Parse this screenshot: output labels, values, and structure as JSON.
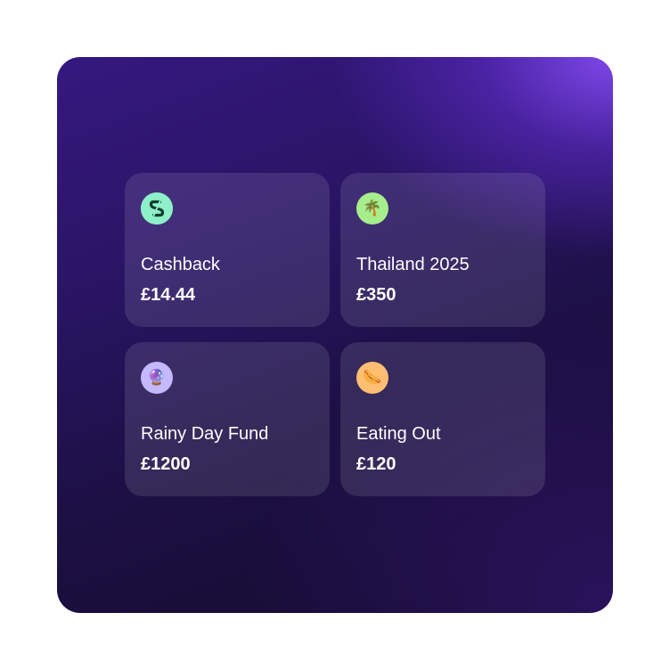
{
  "pots": [
    {
      "name": "Cashback",
      "amount": "£14.44",
      "icon": "cashback-s-icon",
      "icon_glyph": "S",
      "icon_bg": "#8ef0c8",
      "icon_fg": "#0f3d2e"
    },
    {
      "name": "Thailand 2025",
      "amount": "£350",
      "icon": "palm-tree-icon",
      "icon_glyph": "🌴",
      "icon_bg": "#a6ee8c",
      "icon_fg": "#2f6b1a"
    },
    {
      "name": "Rainy Day Fund",
      "amount": "£1200",
      "icon": "crystal-ball-icon",
      "icon_glyph": "🔮",
      "icon_bg": "#c4b8ff",
      "icon_fg": "#6a3fb5"
    },
    {
      "name": "Eating Out",
      "amount": "£120",
      "icon": "hotdog-icon",
      "icon_glyph": "🌭",
      "icon_bg": "#ffbe72",
      "icon_fg": "#8a3b12"
    }
  ],
  "colors": {
    "panel_top_right": "#8c50ff",
    "panel_bottom_left": "#140b2c",
    "card_bg": "rgba(255,255,255,0.11)",
    "text": "#ffffff"
  }
}
